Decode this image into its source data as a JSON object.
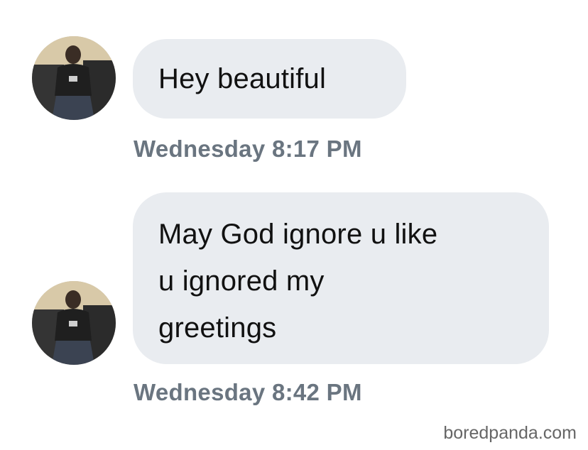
{
  "conversation": {
    "messages": [
      {
        "text": "Hey beautiful",
        "timestamp": "Wednesday 8:17 PM"
      },
      {
        "text": "May God ignore u like\nu ignored my\ngreetings",
        "timestamp": "Wednesday 8:42 PM"
      }
    ]
  },
  "watermark": {
    "text": "boredpanda.com"
  },
  "colors": {
    "bubble_background": "#e9ecf0",
    "timestamp_text": "#6a7580",
    "message_text": "#111111"
  }
}
